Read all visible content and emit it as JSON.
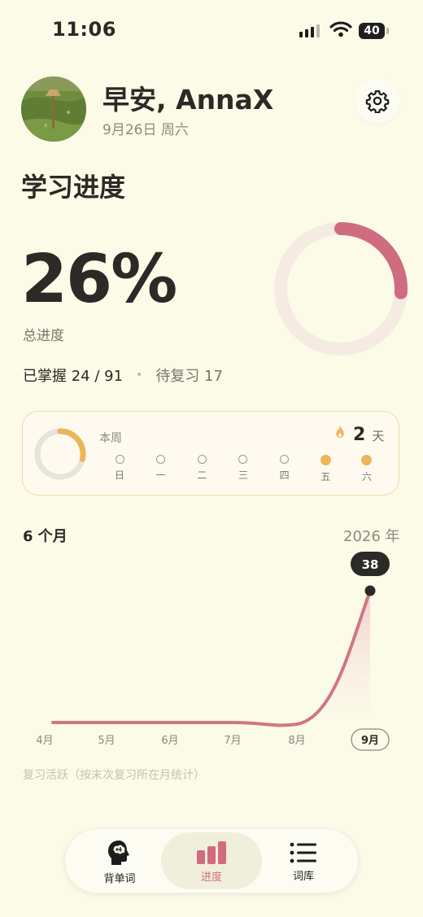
{
  "status_bar": {
    "time": "11:06",
    "battery": "40"
  },
  "header": {
    "greeting": "早安, AnnaX",
    "date": "9月26日 周六"
  },
  "progress": {
    "title": "学习进度",
    "percent_text": "26%",
    "percent_value": 26,
    "total_label": "总进度",
    "mastered_text": "已掌握 24 / 91",
    "review_text": "待复习 17"
  },
  "week": {
    "label": "本周",
    "streak": "2",
    "streak_unit": "天",
    "days": [
      {
        "label": "日",
        "done": false
      },
      {
        "label": "一",
        "done": false
      },
      {
        "label": "二",
        "done": false
      },
      {
        "label": "三",
        "done": false
      },
      {
        "label": "四",
        "done": false
      },
      {
        "label": "五",
        "done": true
      },
      {
        "label": "六",
        "done": true
      }
    ]
  },
  "chart_data": {
    "type": "area",
    "range_label": "6 个月",
    "year_label": "2026 年",
    "x": [
      "4月",
      "5月",
      "6月",
      "7月",
      "8月",
      "9月"
    ],
    "values": [
      0,
      0,
      0,
      0,
      0,
      38
    ],
    "highlight": {
      "x": "9月",
      "value": 38
    },
    "note": "复习活跃（按末次复习所在月统计）",
    "color": "#d27587"
  },
  "tabs": [
    {
      "label": "背单词",
      "icon": "brain-head-icon",
      "active": false
    },
    {
      "label": "进度",
      "icon": "bar-chart-icon",
      "active": true
    },
    {
      "label": "词库",
      "icon": "list-icon",
      "active": false
    }
  ],
  "colors": {
    "accent": "#d06c7f",
    "ring_track": "#f5ebe2",
    "streak": "#ebb559",
    "background": "#fcfbe8"
  }
}
